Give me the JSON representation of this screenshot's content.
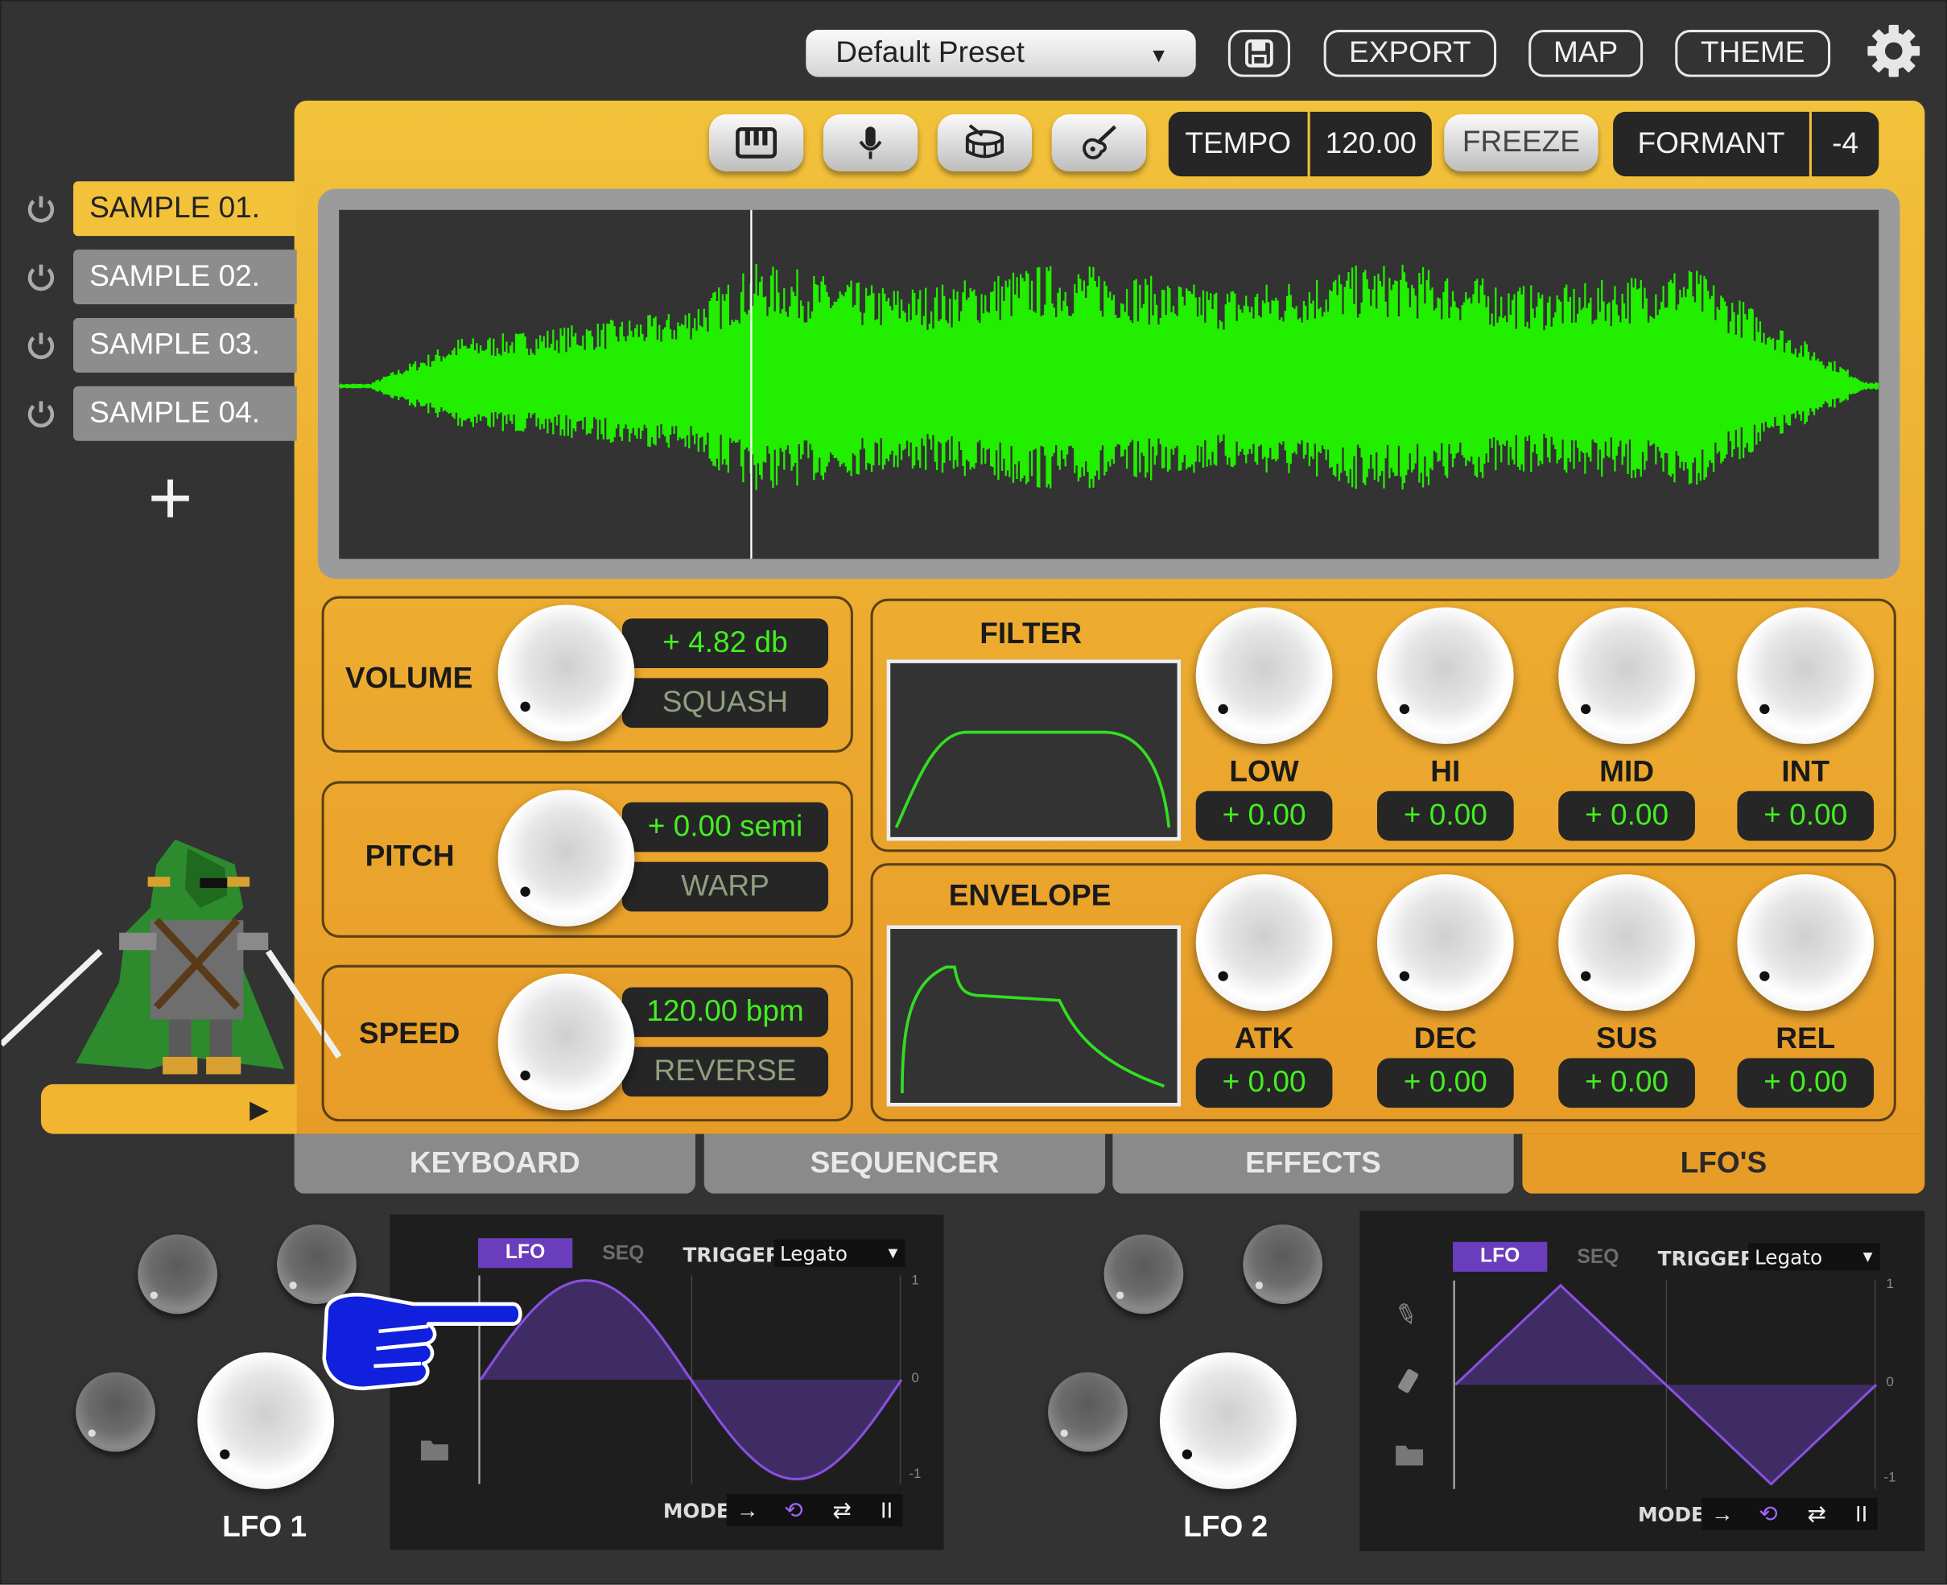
{
  "header": {
    "preset": "Default Preset",
    "export": "EXPORT",
    "map": "MAP",
    "theme": "THEME"
  },
  "icons": {
    "save": "save-icon",
    "settings": "gear-icon",
    "keyboard": "piano-icon",
    "mic": "microphone-icon",
    "drum": "drum-icon",
    "guitar": "guitar-icon"
  },
  "toolbar": {
    "tempo_label": "TEMPO",
    "tempo_value": "120.00",
    "freeze": "FREEZE",
    "formant_label": "FORMANT",
    "formant_value": "-4"
  },
  "samples": [
    "SAMPLE 01.",
    "SAMPLE 02.",
    "SAMPLE 03.",
    "SAMPLE 04."
  ],
  "add_symbol": "+",
  "controls": {
    "volume": {
      "label": "VOLUME",
      "value": "+ 4.82 db",
      "mode": "SQUASH"
    },
    "pitch": {
      "label": "PITCH",
      "value": "+ 0.00 semi",
      "mode": "WARP"
    },
    "speed": {
      "label": "SPEED",
      "value": "120.00 bpm",
      "mode": "REVERSE"
    }
  },
  "filter": {
    "title": "FILTER",
    "knobs": [
      {
        "label": "LOW",
        "value": "+ 0.00"
      },
      {
        "label": "HI",
        "value": "+ 0.00"
      },
      {
        "label": "MID",
        "value": "+ 0.00"
      },
      {
        "label": "INT",
        "value": "+ 0.00"
      }
    ]
  },
  "envelope": {
    "title": "ENVELOPE",
    "knobs": [
      {
        "label": "ATK",
        "value": "+ 0.00"
      },
      {
        "label": "DEC",
        "value": "+ 0.00"
      },
      {
        "label": "SUS",
        "value": "+ 0.00"
      },
      {
        "label": "REL",
        "value": "+ 0.00"
      }
    ]
  },
  "tabs": [
    "KEYBOARD",
    "SEQUENCER",
    "EFFECTS",
    "LFO'S"
  ],
  "active_tab": "LFO'S",
  "lfos": [
    {
      "name": "LFO 1",
      "tab_lfo": "LFO",
      "tab_seq": "SEQ",
      "trigger_label": "TRIGGER",
      "trigger_value": "Legato",
      "mode_label": "MODE",
      "shape": "sine",
      "axis": [
        "1",
        "0",
        "-1"
      ]
    },
    {
      "name": "LFO 2",
      "tab_lfo": "LFO",
      "tab_seq": "SEQ",
      "trigger_label": "TRIGGER",
      "trigger_value": "Legato",
      "mode_label": "MODE",
      "shape": "triangle",
      "axis": [
        "1",
        "0",
        "-1"
      ]
    }
  ],
  "colors": {
    "accent": "#f2c23b",
    "waveform": "#22ee00",
    "lfo_purple": "#6a3dbd",
    "value_green": "#44ee22",
    "pointer_hand": "#1020dd"
  }
}
